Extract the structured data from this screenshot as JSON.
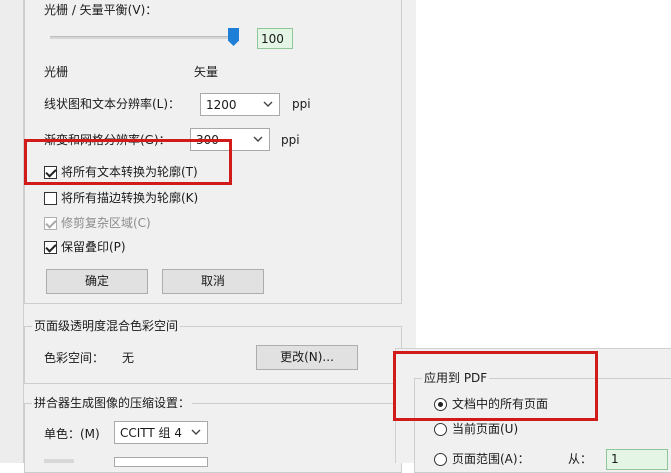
{
  "flattener": {
    "balance_label": "光栅 / 矢量平衡(V)：",
    "balance_value": "100",
    "balance_level": 1.0,
    "raster_label": "光栅",
    "vector_label": "矢量",
    "line_res_label": "线状图和文本分辨率(L)：",
    "line_res_value": "1200",
    "gradient_res_label": "渐变和网格分辨率(G)：",
    "gradient_res_value": "300",
    "ppi_unit": "ppi",
    "options": [
      {
        "label": "将所有文本转换为轮廓(T)",
        "checked": true,
        "disabled": false
      },
      {
        "label": "将所有描边转换为轮廓(K)",
        "checked": false,
        "disabled": false
      },
      {
        "label": "修剪复杂区域(C)",
        "checked": true,
        "disabled": true
      },
      {
        "label": "保留叠印(P)",
        "checked": true,
        "disabled": false
      }
    ],
    "ok_label": "确定",
    "cancel_label": "取消"
  },
  "blend_space": {
    "title": "页面级透明度混合色彩空间",
    "color_space_label": "色彩空间：",
    "color_space_value": "无",
    "change_button": "更改(N)..."
  },
  "compression": {
    "title": "拼合器生成图像的压缩设置：",
    "mono_label": "单色：(M)",
    "mono_value": "CCITT 组 4"
  },
  "apply_to": {
    "title": "应用到 PDF",
    "options": [
      {
        "label": "文档中的所有页面",
        "checked": true
      },
      {
        "label": "当前页面(U)",
        "checked": false
      },
      {
        "label": "页面范围(A)：",
        "checked": false
      }
    ],
    "from_label": "从：",
    "from_value": "1"
  },
  "colors": {
    "highlight": "#d11a1a",
    "accent": "#1f7fd6"
  }
}
